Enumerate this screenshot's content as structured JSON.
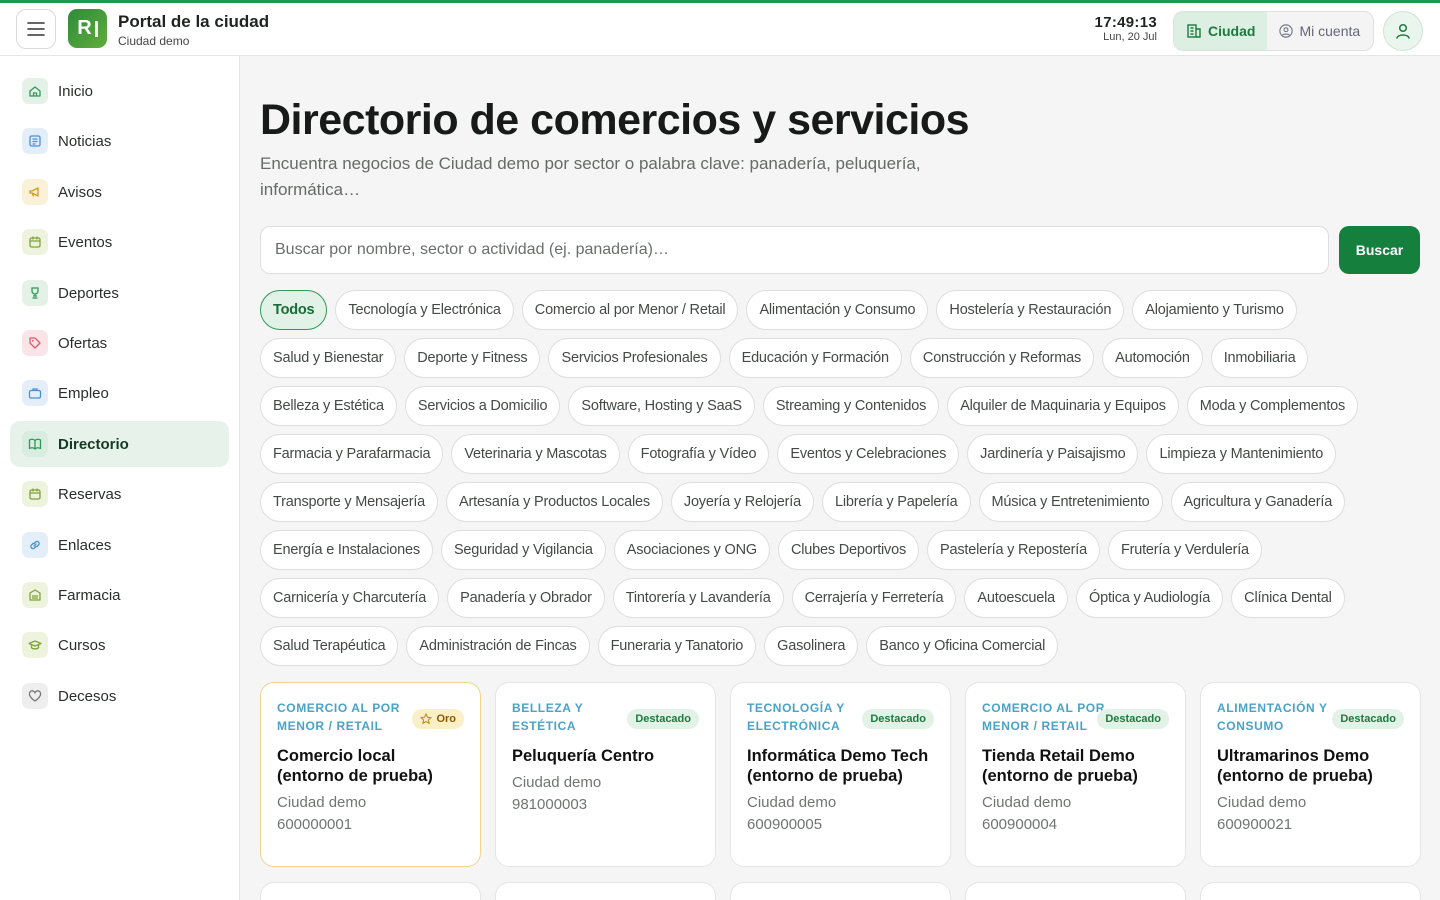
{
  "header": {
    "logo_letter": "R",
    "title": "Portal de la ciudad",
    "subtitle": "Ciudad demo",
    "time": "17:49:13",
    "date": "Lun, 20 Jul",
    "tabs": [
      {
        "label": "Ciudad",
        "icon": "building-icon",
        "active": true
      },
      {
        "label": "Mi cuenta",
        "icon": "user-circle-icon",
        "active": false
      }
    ]
  },
  "sidebar": {
    "items": [
      {
        "label": "Inicio",
        "icon": "home-icon",
        "color": "#2f9a58",
        "bg": "#e3f1e6"
      },
      {
        "label": "Noticias",
        "icon": "newspaper-icon",
        "color": "#4a8fd6",
        "bg": "#e4eef9"
      },
      {
        "label": "Avisos",
        "icon": "megaphone-icon",
        "color": "#d49a1c",
        "bg": "#fbf1d9"
      },
      {
        "label": "Eventos",
        "icon": "calendar-icon",
        "color": "#7ea33a",
        "bg": "#eef3de"
      },
      {
        "label": "Deportes",
        "icon": "trophy-icon",
        "color": "#2f9a58",
        "bg": "#e3f1e6"
      },
      {
        "label": "Ofertas",
        "icon": "tag-icon",
        "color": "#e05a6b",
        "bg": "#fbe4e7"
      },
      {
        "label": "Empleo",
        "icon": "briefcase-icon",
        "color": "#4a8fd6",
        "bg": "#e4eef9"
      },
      {
        "label": "Directorio",
        "icon": "book-icon",
        "color": "#2f9a58",
        "bg": "#d8ecdf",
        "active": true
      },
      {
        "label": "Reservas",
        "icon": "calendar-check-icon",
        "color": "#7ea33a",
        "bg": "#eef3de"
      },
      {
        "label": "Enlaces",
        "icon": "link-icon",
        "color": "#4a8fd6",
        "bg": "#e4eef9"
      },
      {
        "label": "Farmacia",
        "icon": "pharmacy-icon",
        "color": "#7ea33a",
        "bg": "#eef3de"
      },
      {
        "label": "Cursos",
        "icon": "graduation-cap-icon",
        "color": "#7ea33a",
        "bg": "#eef3de"
      },
      {
        "label": "Decesos",
        "icon": "heart-icon",
        "color": "#777",
        "bg": "#eeeeee"
      }
    ]
  },
  "main": {
    "title": "Directorio de comercios y servicios",
    "subtitle": "Encuentra negocios de Ciudad demo por sector o palabra clave: panadería, peluquería, informática…",
    "search_placeholder": "Buscar por nombre, sector o actividad (ej. panadería)…",
    "search_button": "Buscar",
    "categories": [
      "Todos",
      "Tecnología y Electrónica",
      "Comercio al por Menor / Retail",
      "Alimentación y Consumo",
      "Hostelería y Restauración",
      "Alojamiento y Turismo",
      "Salud y Bienestar",
      "Deporte y Fitness",
      "Servicios Profesionales",
      "Educación y Formación",
      "Construcción y Reformas",
      "Automoción",
      "Inmobiliaria",
      "Belleza y Estética",
      "Servicios a Domicilio",
      "Software, Hosting y SaaS",
      "Streaming y Contenidos",
      "Alquiler de Maquinaria y Equipos",
      "Moda y Complementos",
      "Farmacia y Parafarmacia",
      "Veterinaria y Mascotas",
      "Fotografía y Vídeo",
      "Eventos y Celebraciones",
      "Jardinería y Paisajismo",
      "Limpieza y Mantenimiento",
      "Transporte y Mensajería",
      "Artesanía y Productos Locales",
      "Joyería y Relojería",
      "Librería y Papelería",
      "Música y Entretenimiento",
      "Agricultura y Ganadería",
      "Energía e Instalaciones",
      "Seguridad y Vigilancia",
      "Asociaciones y ONG",
      "Clubes Deportivos",
      "Pastelería y Repostería",
      "Frutería y Verdulería",
      "Carnicería y Charcutería",
      "Panadería y Obrador",
      "Tintorería y Lavandería",
      "Cerrajería y Ferretería",
      "Autoescuela",
      "Óptica y Audiología",
      "Clínica Dental",
      "Salud Terapéutica",
      "Administración de Fincas",
      "Funeraria y Tanatorio",
      "Gasolinera",
      "Banco y Oficina Comercial"
    ],
    "active_category": "Todos",
    "cards": [
      {
        "category": "Comercio al por Menor / Retail",
        "badge": "Oro",
        "badge_type": "gold",
        "name": "Comercio local (entorno de prueba)",
        "city": "Ciudad demo",
        "phone": "600000001"
      },
      {
        "category": "Belleza y Estética",
        "badge": "Destacado",
        "badge_type": "dest",
        "name": "Peluquería Centro",
        "city": "Ciudad demo",
        "phone": "981000003"
      },
      {
        "category": "Tecnología y Electrónica",
        "badge": "Destacado",
        "badge_type": "dest",
        "name": "Informática Demo Tech (entorno de prueba)",
        "city": "Ciudad demo",
        "phone": "600900005"
      },
      {
        "category": "Comercio al por Menor / Retail",
        "badge": "Destacado",
        "badge_type": "dest",
        "name": "Tienda Retail Demo (entorno de prueba)",
        "city": "Ciudad demo",
        "phone": "600900004"
      },
      {
        "category": "Alimentación y Consumo",
        "badge": "Destacado",
        "badge_type": "dest",
        "name": "Ultramarinos Demo (entorno de prueba)",
        "city": "Ciudad demo",
        "phone": "600900021"
      }
    ]
  }
}
